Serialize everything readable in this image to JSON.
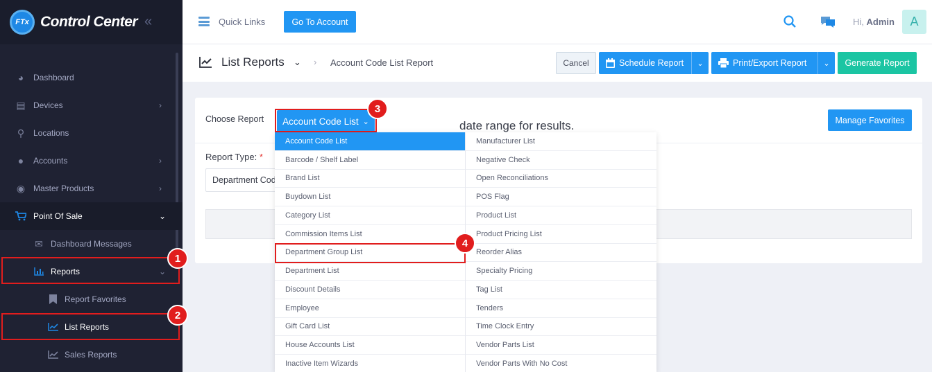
{
  "brand": {
    "logo_text": "FTx",
    "name": "Control Center"
  },
  "sidebar": {
    "items": [
      {
        "label": "Dashboard"
      },
      {
        "label": "Devices"
      },
      {
        "label": "Locations"
      },
      {
        "label": "Accounts"
      },
      {
        "label": "Master Products"
      },
      {
        "label": "Point Of Sale"
      },
      {
        "label": "Dashboard Messages"
      },
      {
        "label": "Reports"
      },
      {
        "label": "Report Favorites"
      },
      {
        "label": "List Reports"
      },
      {
        "label": "Sales Reports"
      }
    ]
  },
  "callouts": [
    "1",
    "2",
    "3",
    "4"
  ],
  "topbar": {
    "quick_links": "Quick Links",
    "go_to_account": "Go To Account",
    "greeting": "Hi,",
    "user": "Admin",
    "avatar_letter": "A"
  },
  "subheader": {
    "title": "List Reports",
    "breadcrumb": "Account Code List Report",
    "cancel": "Cancel",
    "schedule": "Schedule Report",
    "print_export": "Print/Export Report",
    "generate": "Generate Report"
  },
  "card": {
    "choose_label": "Choose Report",
    "selected_report": "Account Code List",
    "manage_favorites": "Manage Favorites",
    "report_type_label": "Report Type:",
    "report_type_required": "*",
    "report_type_value": "Department Code",
    "info_text": "date range for results."
  },
  "dropdown": {
    "left": [
      "Account Code List",
      "Barcode / Shelf Label",
      "Brand List",
      "Buydown List",
      "Category List",
      "Commission Items List",
      "Department Group List",
      "Department List",
      "Discount Details",
      "Employee",
      "Gift Card List",
      "House Accounts List",
      "Inactive Item Wizards"
    ],
    "right": [
      "Manufacturer List",
      "Negative Check",
      "Open Reconciliations",
      "POS Flag",
      "Product List",
      "Product Pricing List",
      "Reorder Alias",
      "Specialty Pricing",
      "Tag List",
      "Tenders",
      "Time Clock Entry",
      "Vendor Parts List",
      "Vendor Parts With No Cost"
    ]
  },
  "colors": {
    "accent": "#2196f3",
    "sidebar_bg": "#1f2233",
    "callout": "#e11d1d",
    "generate": "#1bc5a3"
  }
}
